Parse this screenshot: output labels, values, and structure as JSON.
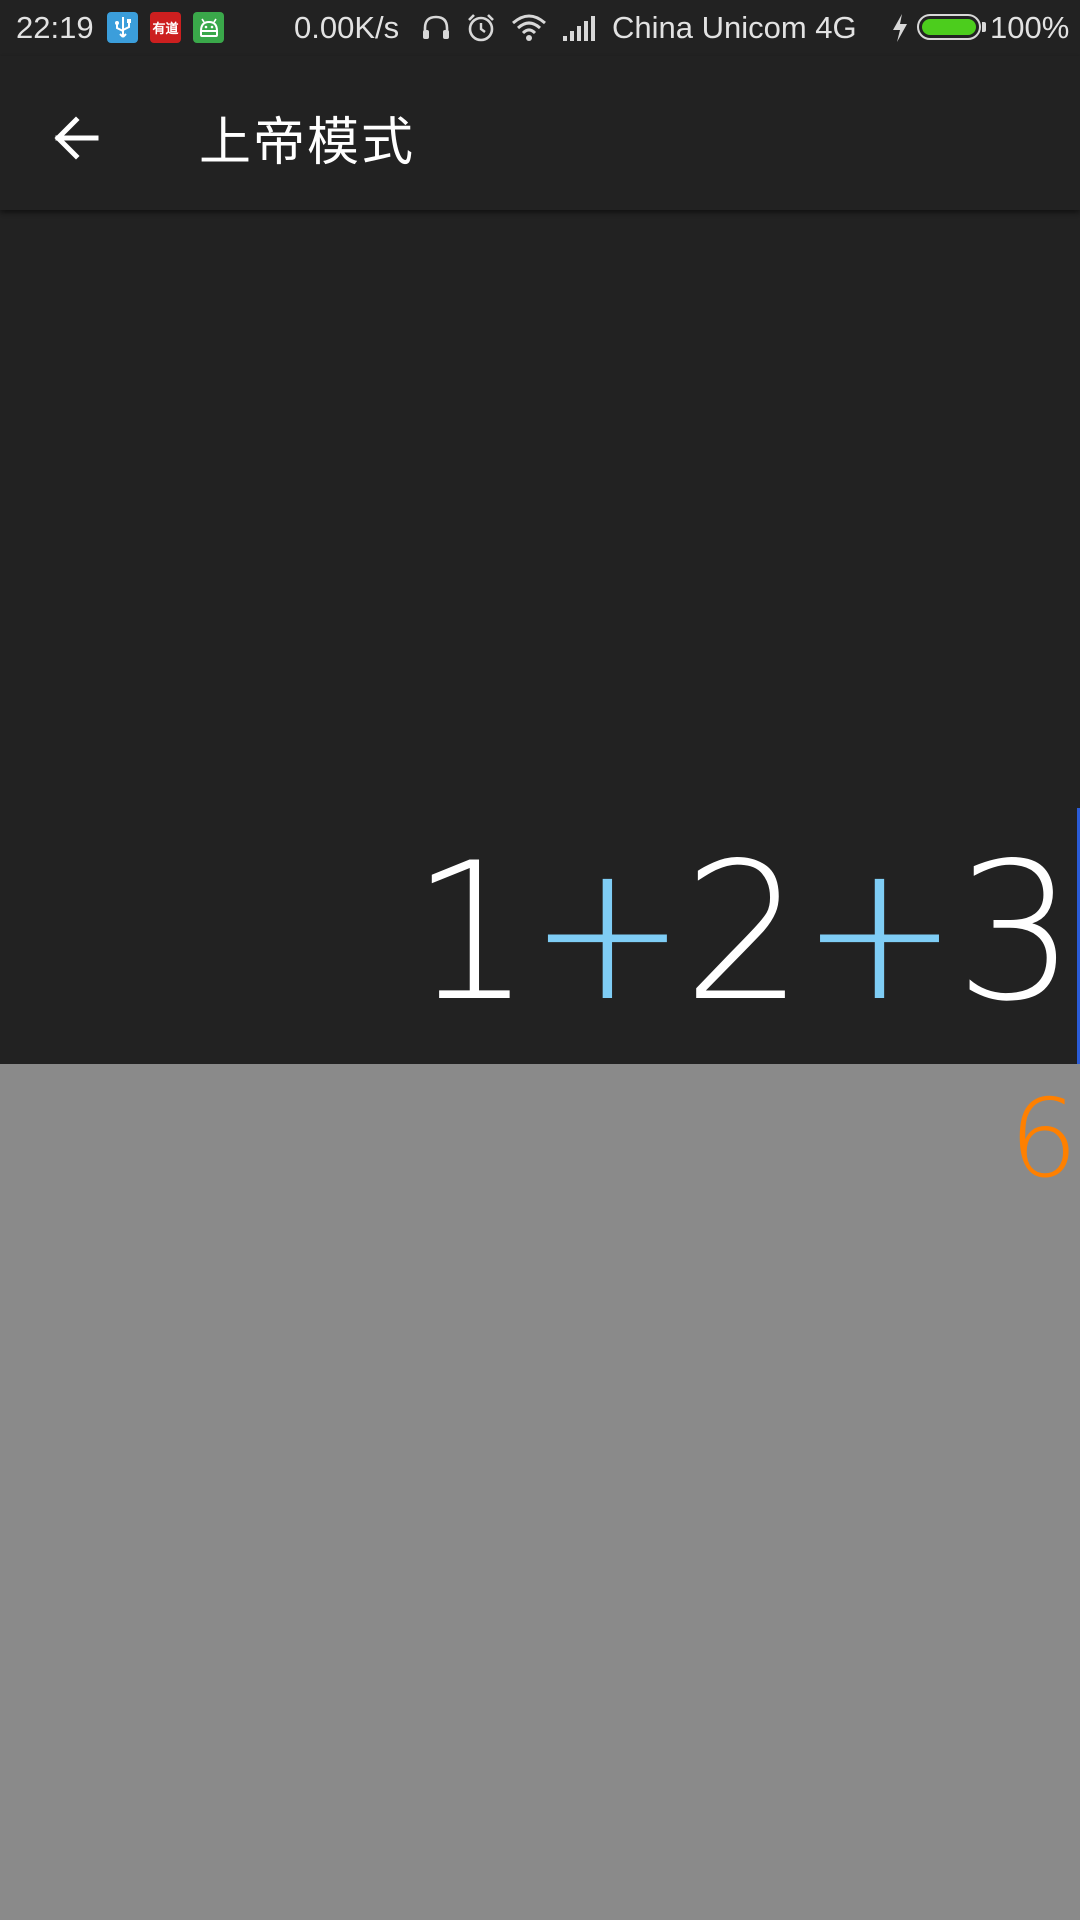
{
  "status_bar": {
    "time": "22:19",
    "app_icons": [
      "usb-icon",
      "youdao-icon",
      "android-icon"
    ],
    "youdao_label": "有道",
    "net_speed": "0.00K/s",
    "icons": [
      "headset-icon",
      "alarm-icon",
      "wifi-icon",
      "signal-icon",
      "charging-icon",
      "battery-icon"
    ],
    "carrier": "China  Unicom  4G",
    "battery_percent": "100%",
    "battery_level": 1.0,
    "battery_color": "#4ccd1d"
  },
  "app_bar": {
    "back_icon": "arrow-left-icon",
    "title": "上帝模式"
  },
  "display": {
    "expression_parts": [
      {
        "text": "1",
        "kind": "number"
      },
      {
        "text": "+",
        "kind": "operator"
      },
      {
        "text": "2",
        "kind": "number"
      },
      {
        "text": "+",
        "kind": "operator"
      },
      {
        "text": "3",
        "kind": "number"
      }
    ],
    "operator_color": "#7fcdf5",
    "cursor_color": "#2a5cd8"
  },
  "result": {
    "value": "6",
    "color": "#ff8000"
  },
  "colors": {
    "background": "#222222",
    "result_panel": "#8a8a8a"
  }
}
